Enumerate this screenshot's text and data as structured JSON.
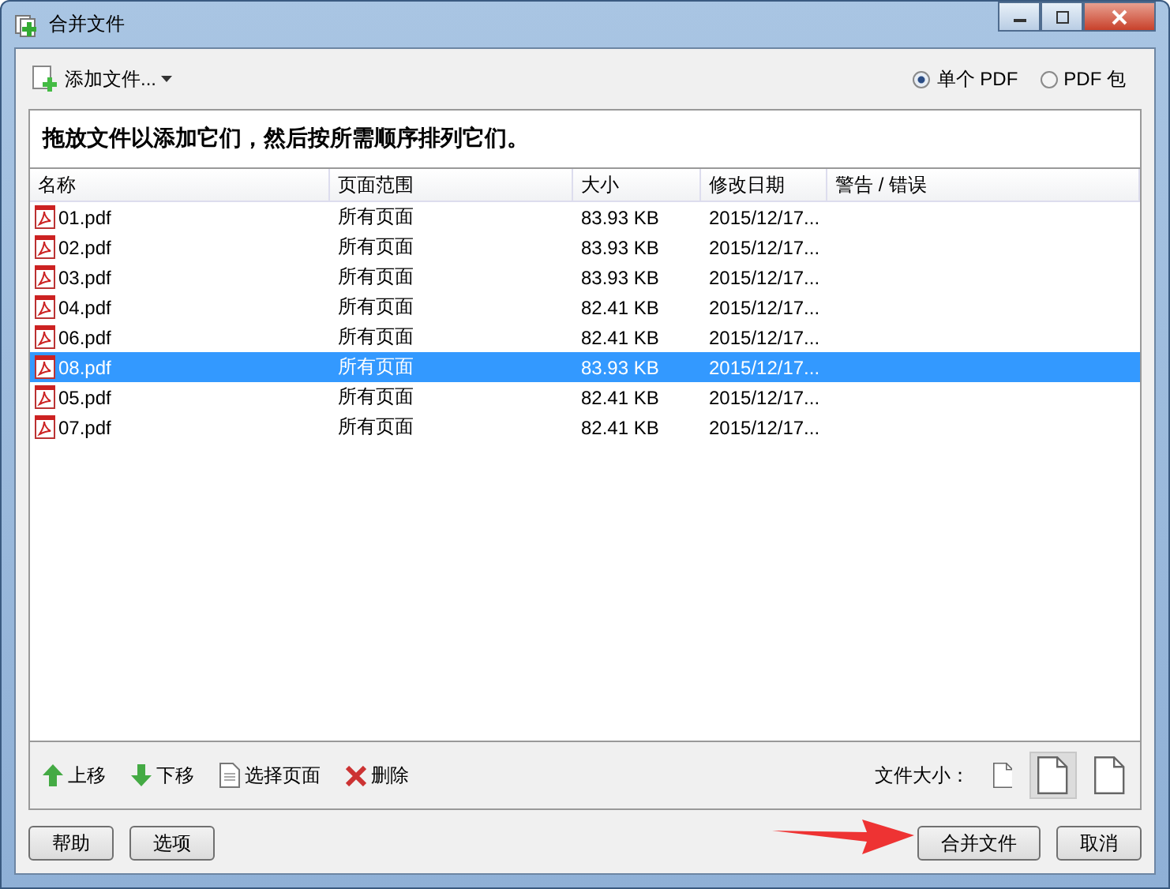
{
  "window": {
    "title": "合并文件"
  },
  "toolbar": {
    "add_files": "添加文件...",
    "output_modes": [
      {
        "label": "单个 PDF",
        "selected": true
      },
      {
        "label": "PDF 包",
        "selected": false
      }
    ]
  },
  "instruction": "拖放文件以添加它们，然后按所需顺序排列它们。",
  "table": {
    "columns": [
      "名称",
      "页面范围",
      "大小",
      "修改日期",
      "警告 / 错误"
    ],
    "rows": [
      {
        "name": "01.pdf",
        "range": "所有页面",
        "size": "83.93 KB",
        "date": "2015/12/17...",
        "selected": false
      },
      {
        "name": "02.pdf",
        "range": "所有页面",
        "size": "83.93 KB",
        "date": "2015/12/17...",
        "selected": false
      },
      {
        "name": "03.pdf",
        "range": "所有页面",
        "size": "83.93 KB",
        "date": "2015/12/17...",
        "selected": false
      },
      {
        "name": "04.pdf",
        "range": "所有页面",
        "size": "82.41 KB",
        "date": "2015/12/17...",
        "selected": false
      },
      {
        "name": "06.pdf",
        "range": "所有页面",
        "size": "82.41 KB",
        "date": "2015/12/17...",
        "selected": false
      },
      {
        "name": "08.pdf",
        "range": "所有页面",
        "size": "83.93 KB",
        "date": "2015/12/17...",
        "selected": true
      },
      {
        "name": "05.pdf",
        "range": "所有页面",
        "size": "82.41 KB",
        "date": "2015/12/17...",
        "selected": false
      },
      {
        "name": "07.pdf",
        "range": "所有页面",
        "size": "82.41 KB",
        "date": "2015/12/17...",
        "selected": false
      }
    ]
  },
  "actions": [
    {
      "kind": "up",
      "label": "上移"
    },
    {
      "kind": "down",
      "label": "下移"
    },
    {
      "kind": "pages",
      "label": "选择页面"
    },
    {
      "kind": "delete",
      "label": "删除"
    }
  ],
  "file_size": {
    "label": "文件大小：",
    "options": [
      {
        "selected": false
      },
      {
        "selected": true
      },
      {
        "selected": false
      }
    ]
  },
  "buttons_left": [
    "帮助",
    "选项"
  ],
  "buttons_right": [
    "合并文件",
    "取消"
  ]
}
